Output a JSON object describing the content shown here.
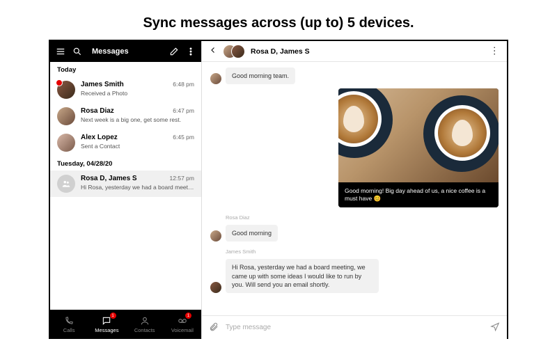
{
  "headline": "Sync messages across (up to) 5 devices.",
  "sidebar": {
    "title": "Messages",
    "sections": [
      {
        "label": "Today",
        "items": [
          {
            "name": "James Smith",
            "preview": "Received a Photo",
            "time": "6:48 pm",
            "unread": true
          },
          {
            "name": "Rosa Diaz",
            "preview": "Next week is a big one, get some rest.",
            "time": "6:47 pm",
            "unread": false
          },
          {
            "name": "Alex Lopez",
            "preview": "Sent a Contact",
            "time": "6:45 pm",
            "unread": false
          }
        ]
      },
      {
        "label": "Tuesday, 04/28/20",
        "items": [
          {
            "name": "Rosa D, James S",
            "preview": "Hi Rosa, yesterday we had a board meeting, we…",
            "time": "12:57 pm",
            "unread": false,
            "selected": true,
            "group": true
          }
        ]
      }
    ]
  },
  "nav": {
    "items": [
      {
        "label": "Calls",
        "icon": "phone"
      },
      {
        "label": "Messages",
        "icon": "message",
        "active": true,
        "badge": "1"
      },
      {
        "label": "Contacts",
        "icon": "contacts"
      },
      {
        "label": "Voicemail",
        "icon": "voicemail",
        "badge": "1"
      }
    ]
  },
  "chat": {
    "title": "Rosa D, James S",
    "messages": [
      {
        "dir": "in",
        "text": "Good morning team."
      },
      {
        "dir": "out",
        "type": "photo",
        "caption": "Good morning! Big day ahead of us, a nice coffee is a must have 😊"
      },
      {
        "dir": "in",
        "sender": "Rosa Diaz",
        "text": "Good morning"
      },
      {
        "dir": "in",
        "sender": "James Smith",
        "text": "Hi Rosa, yesterday we had a board meeting, we came up with some ideas I would like to run by you. Will send you an email shortly."
      }
    ],
    "composer_placeholder": "Type message"
  }
}
